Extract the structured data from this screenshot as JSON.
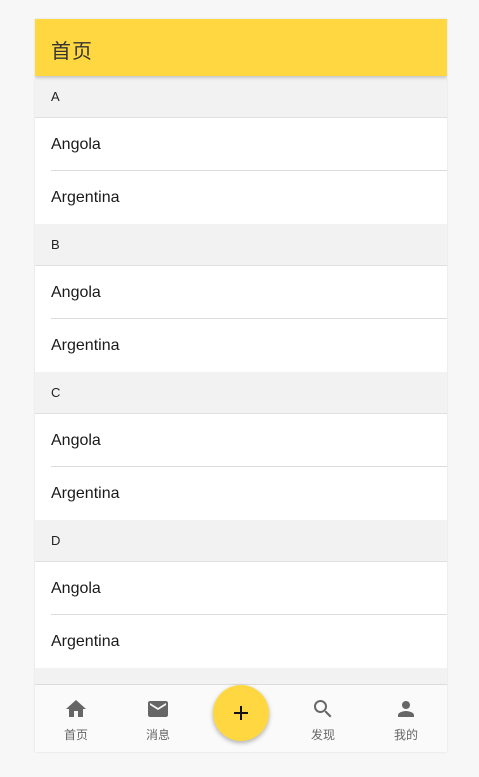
{
  "header": {
    "title": "首页"
  },
  "sections": [
    {
      "letter": "A",
      "items": [
        "Angola",
        "Argentina"
      ]
    },
    {
      "letter": "B",
      "items": [
        "Angola",
        "Argentina"
      ]
    },
    {
      "letter": "C",
      "items": [
        "Angola",
        "Argentina"
      ]
    },
    {
      "letter": "D",
      "items": [
        "Angola",
        "Argentina"
      ]
    }
  ],
  "bottom_nav": [
    {
      "label": "首页",
      "icon": "home-icon"
    },
    {
      "label": "消息",
      "icon": "mail-icon"
    },
    {
      "label": "发现",
      "icon": "search-icon"
    },
    {
      "label": "我的",
      "icon": "person-icon"
    }
  ],
  "fab": {
    "icon": "plus-icon"
  },
  "colors": {
    "accent": "#ffd841",
    "section_bg": "#f2f2f2",
    "icon": "#666666"
  }
}
